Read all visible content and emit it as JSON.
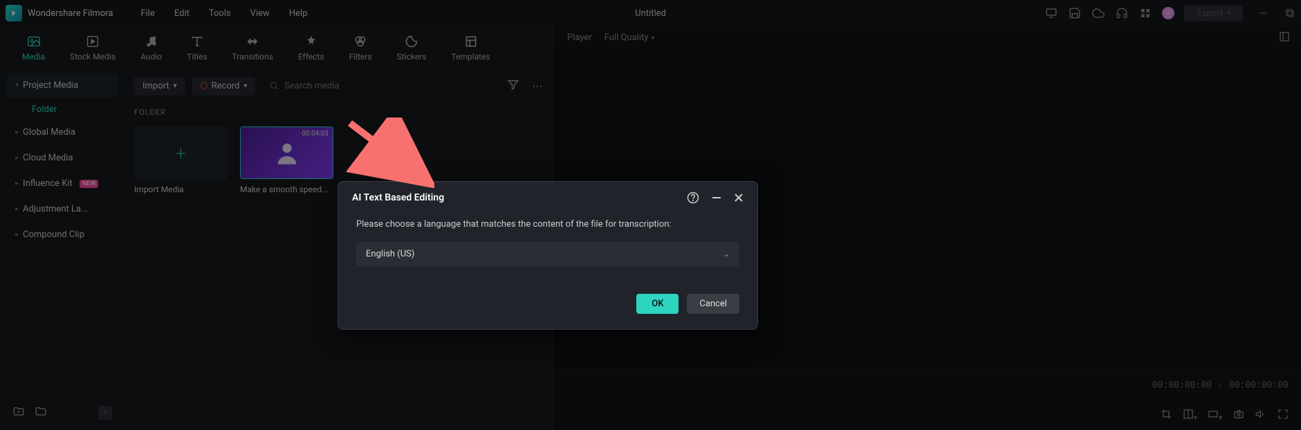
{
  "app": {
    "title": "Wondershare Filmora"
  },
  "menu": {
    "file": "File",
    "edit": "Edit",
    "tools": "Tools",
    "view": "View",
    "help": "Help"
  },
  "doc": {
    "title": "Untitled"
  },
  "titlebar": {
    "export": "Export"
  },
  "tabs": {
    "media": "Media",
    "stock": "Stock Media",
    "audio": "Audio",
    "titles": "Titles",
    "transitions": "Transitions",
    "effects": "Effects",
    "filters": "Filters",
    "stickers": "Stickers",
    "templates": "Templates"
  },
  "sidebar": {
    "project_media": "Project Media",
    "folder": "Folder",
    "global_media": "Global Media",
    "cloud_media": "Cloud Media",
    "influence_kit": "Influence Kit",
    "influence_badge": "NEW",
    "adjustment": "Adjustment La...",
    "compound": "Compound Clip"
  },
  "media_toolbar": {
    "import": "Import",
    "record": "Record",
    "search_placeholder": "Search media"
  },
  "folder_header": "FOLDER",
  "thumbs": {
    "import_label": "Import Media",
    "clip_label": "Make a smooth speed...",
    "clip_duration": "00:04:03"
  },
  "player": {
    "label": "Player",
    "quality": "Full Quality"
  },
  "timeline": {
    "tc1": "00:00:00:00",
    "tc2": "00:00:00:00"
  },
  "modal": {
    "title": "AI Text Based Editing",
    "desc": "Please choose a language that matches the content of the file for transcription:",
    "language": "English (US)",
    "ok": "OK",
    "cancel": "Cancel"
  }
}
